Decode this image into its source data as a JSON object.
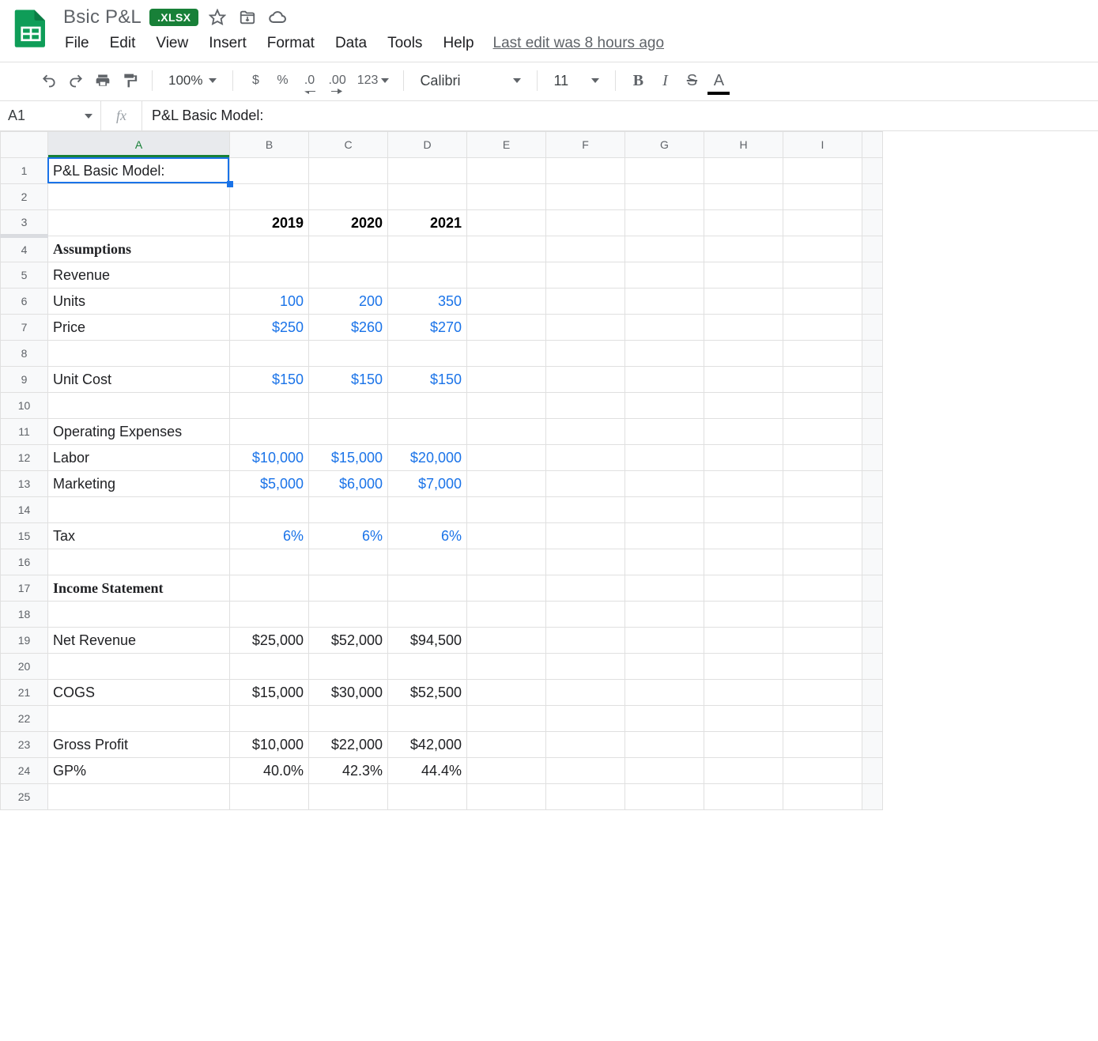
{
  "app": {
    "title": "Bsic P&L",
    "badge": ".XLSX",
    "last_edit": "Last edit was 8 hours ago"
  },
  "menus": {
    "file": "File",
    "edit": "Edit",
    "view": "View",
    "insert": "Insert",
    "format": "Format",
    "data": "Data",
    "tools": "Tools",
    "help": "Help"
  },
  "toolbar": {
    "zoom": "100%",
    "currency": "$",
    "percent": "%",
    "dec_dec": ".0",
    "inc_dec": ".00",
    "more_formats": "123",
    "font": "Calibri",
    "font_size": "11",
    "bold": "B",
    "italic": "I",
    "strike": "S",
    "textcolor": "A"
  },
  "formula": {
    "name_box": "A1",
    "fx_label": "fx",
    "text": "P&L Basic Model:"
  },
  "columns": [
    "A",
    "B",
    "C",
    "D",
    "E",
    "F",
    "G",
    "H",
    "I"
  ],
  "rows": [
    {
      "n": "1",
      "a": "P&L Basic Model:",
      "b": "",
      "c": "",
      "d": ""
    },
    {
      "n": "2",
      "a": "",
      "b": "",
      "c": "",
      "d": ""
    },
    {
      "n": "3",
      "a": "",
      "b": "2019",
      "c": "2020",
      "d": "2021",
      "years": true
    },
    {
      "n": "4",
      "a": "Assumptions",
      "bold": true
    },
    {
      "n": "5",
      "a": "Revenue"
    },
    {
      "n": "6",
      "a": "Units",
      "b": "100",
      "c": "200",
      "d": "350",
      "blue": true
    },
    {
      "n": "7",
      "a": "Price",
      "b": "$250",
      "c": "$260",
      "d": "$270",
      "blue": true
    },
    {
      "n": "8",
      "a": ""
    },
    {
      "n": "9",
      "a": "Unit Cost",
      "b": "$150",
      "c": "$150",
      "d": "$150",
      "blue": true
    },
    {
      "n": "10",
      "a": ""
    },
    {
      "n": "11",
      "a": "Operating Expenses"
    },
    {
      "n": "12",
      "a": "Labor",
      "b": "$10,000",
      "c": "$15,000",
      "d": "$20,000",
      "blue": true
    },
    {
      "n": "13",
      "a": "Marketing",
      "b": "$5,000",
      "c": "$6,000",
      "d": "$7,000",
      "blue": true
    },
    {
      "n": "14",
      "a": ""
    },
    {
      "n": "15",
      "a": "Tax",
      "b": "6%",
      "c": "6%",
      "d": "6%",
      "blue": true
    },
    {
      "n": "16",
      "a": ""
    },
    {
      "n": "17",
      "a": "Income Statement",
      "bold": true
    },
    {
      "n": "18",
      "a": ""
    },
    {
      "n": "19",
      "a": "Net Revenue",
      "b": "$25,000",
      "c": "$52,000",
      "d": "$94,500"
    },
    {
      "n": "20",
      "a": ""
    },
    {
      "n": "21",
      "a": "COGS",
      "b": "$15,000",
      "c": "$30,000",
      "d": "$52,500"
    },
    {
      "n": "22",
      "a": ""
    },
    {
      "n": "23",
      "a": "Gross Profit",
      "b": "$10,000",
      "c": "$22,000",
      "d": "$42,000"
    },
    {
      "n": "24",
      "a": "GP%",
      "b": "40.0%",
      "c": "42.3%",
      "d": "44.4%"
    },
    {
      "n": "25",
      "a": ""
    }
  ],
  "chart_data": {
    "type": "table",
    "title": "P&L Basic Model:",
    "years": [
      2019,
      2020,
      2021
    ],
    "assumptions": {
      "units": [
        100,
        200,
        350
      ],
      "price": [
        250,
        260,
        270
      ],
      "unit_cost": [
        150,
        150,
        150
      ],
      "labor": [
        10000,
        15000,
        20000
      ],
      "marketing": [
        5000,
        6000,
        7000
      ],
      "tax_rate": [
        0.06,
        0.06,
        0.06
      ]
    },
    "income_statement": {
      "net_revenue": [
        25000,
        52000,
        94500
      ],
      "cogs": [
        15000,
        30000,
        52500
      ],
      "gross_profit": [
        10000,
        22000,
        42000
      ],
      "gp_pct": [
        0.4,
        0.423,
        0.444
      ]
    }
  }
}
